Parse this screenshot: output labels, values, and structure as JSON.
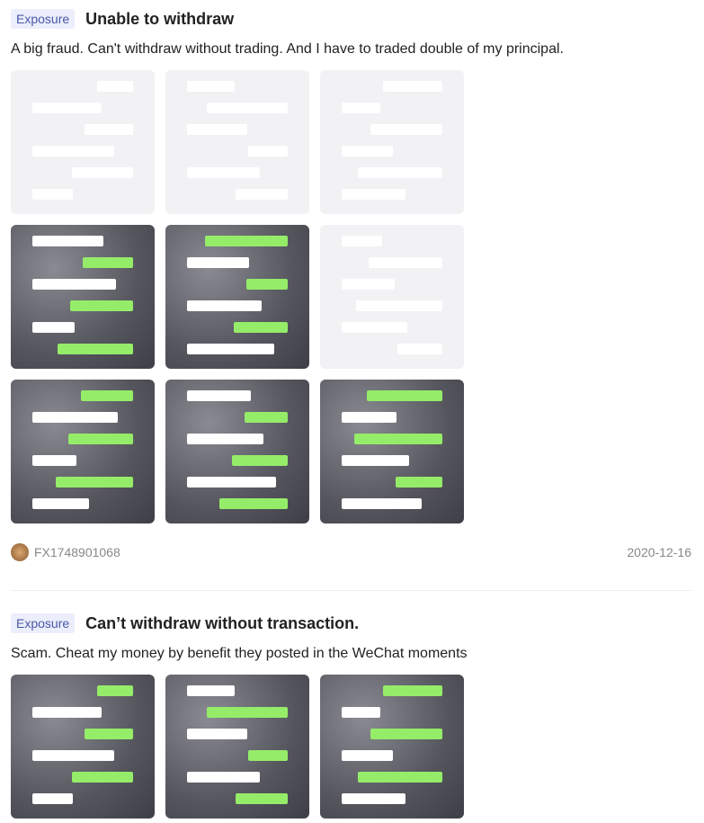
{
  "posts": [
    {
      "tag": "Exposure",
      "title": "Unable to withdraw",
      "description": "A big fraud. Can't withdraw without trading. And I have to traded double of my principal.",
      "images": [
        "light",
        "light",
        "light",
        "dark",
        "dark",
        "light",
        "dark",
        "dark",
        "dark"
      ],
      "user": "FX1748901068",
      "date": "2020-12-16"
    },
    {
      "tag": "Exposure",
      "title": "Can’t withdraw without transaction.",
      "description": "Scam. Cheat my money by benefit they posted in the WeChat moments",
      "images": [
        "dark",
        "dark",
        "dark"
      ]
    }
  ],
  "colors": {
    "tag_bg": "#eceefb",
    "tag_text": "#4a58a8",
    "chat_green": "#95ec69"
  }
}
